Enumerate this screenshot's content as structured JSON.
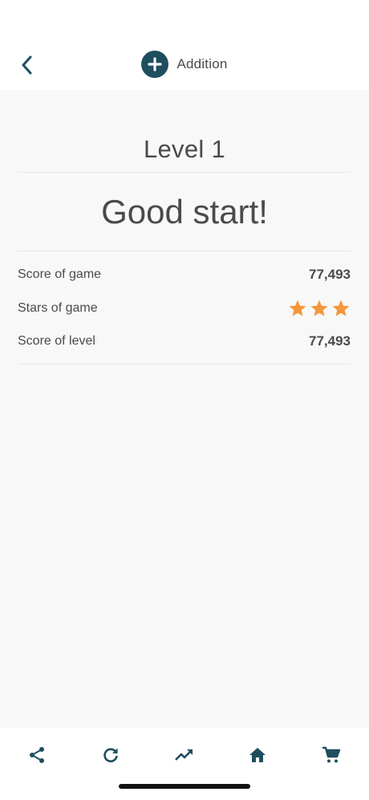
{
  "header": {
    "title": "Addition",
    "back_icon": "chevron-left-icon",
    "operation_icon": "plus-circle-icon",
    "accent_color": "#1f4e5f"
  },
  "main": {
    "level_title": "Level 1",
    "result_title": "Good start!",
    "stats": [
      {
        "label": "Score of game",
        "value": "77,493"
      },
      {
        "label": "Stars of game",
        "stars": 3,
        "star_color": "#f5963a"
      },
      {
        "label": "Score of level",
        "value": "77,493"
      }
    ]
  },
  "bottom_nav": {
    "items": [
      {
        "icon": "share-icon"
      },
      {
        "icon": "refresh-icon"
      },
      {
        "icon": "trending-up-icon"
      },
      {
        "icon": "home-icon"
      },
      {
        "icon": "cart-icon"
      }
    ]
  }
}
